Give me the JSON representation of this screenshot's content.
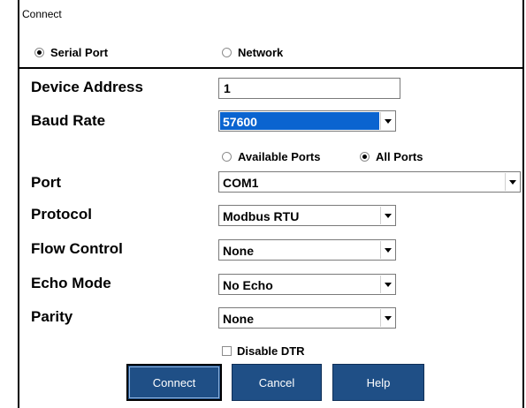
{
  "window": {
    "title": "Connect"
  },
  "connection_type": {
    "options": [
      {
        "label": "Serial Port",
        "selected": true
      },
      {
        "label": "Network",
        "selected": false
      }
    ]
  },
  "fields": {
    "device_address": {
      "label": "Device Address",
      "value": "1"
    },
    "baud_rate": {
      "label": "Baud Rate",
      "value": "57600"
    },
    "port_filter": {
      "options": [
        {
          "label": "Available Ports",
          "selected": false
        },
        {
          "label": "All Ports",
          "selected": true
        }
      ]
    },
    "port": {
      "label": "Port",
      "value": "COM1"
    },
    "protocol": {
      "label": "Protocol",
      "value": "Modbus RTU"
    },
    "flow_control": {
      "label": "Flow Control",
      "value": "None"
    },
    "echo_mode": {
      "label": "Echo Mode",
      "value": "No Echo"
    },
    "parity": {
      "label": "Parity",
      "value": "None"
    },
    "disable_dtr": {
      "label": "Disable DTR",
      "checked": false
    }
  },
  "buttons": {
    "connect": "Connect",
    "cancel": "Cancel",
    "help": "Help"
  },
  "colors": {
    "button": "#1f4f86",
    "selection": "#0a64d0"
  }
}
